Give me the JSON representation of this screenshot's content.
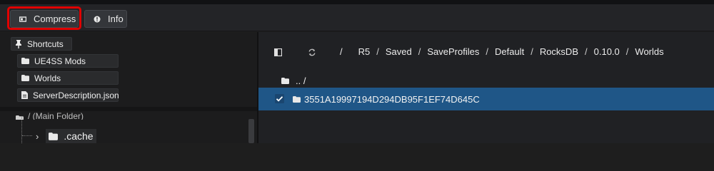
{
  "toolbar": {
    "compress_label": "Compress",
    "info_label": "Info"
  },
  "shortcuts": {
    "header": "Shortcuts",
    "items": [
      {
        "label": "UE4SS Mods",
        "icon": "folder-icon"
      },
      {
        "label": "Worlds",
        "icon": "folder-icon"
      },
      {
        "label": "ServerDescription.json",
        "icon": "file-icon"
      }
    ]
  },
  "tree": {
    "root_label": "/ (Main Folder)",
    "child_label": ".cache"
  },
  "path": {
    "root": "/",
    "segments": [
      "R5",
      "Saved",
      "SaveProfiles",
      "Default",
      "RocksDB",
      "0.10.0",
      "Worlds"
    ],
    "separator": "/"
  },
  "files": {
    "parent_label": ".. /",
    "selected_folder": "3551A19997194D294DB95F1EF74D645C"
  },
  "colors": {
    "highlight": "#e00000",
    "selection": "#1f5687"
  }
}
